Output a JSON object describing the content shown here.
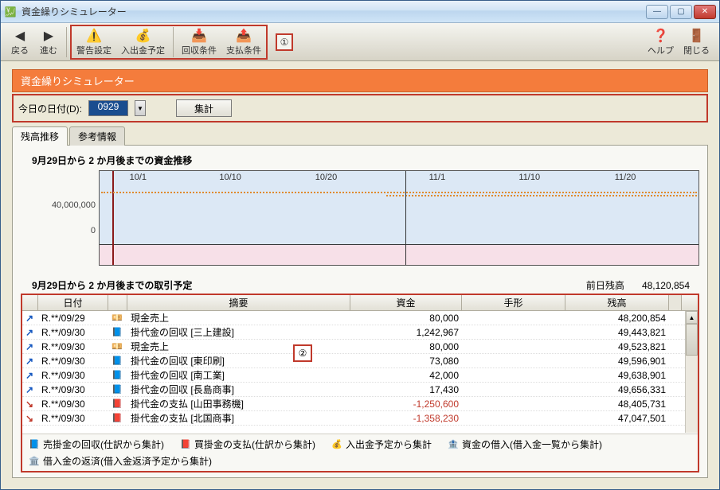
{
  "window": {
    "title": "資金繰りシミュレーター"
  },
  "toolbar": {
    "back": "戻る",
    "forward": "進む",
    "warn": "警告設定",
    "inout": "入出金予定",
    "kaishu": "回収条件",
    "shiharai": "支払条件",
    "help": "ヘルプ",
    "close": "閉じる"
  },
  "callouts": {
    "one": "①",
    "two": "②"
  },
  "header": {
    "title": "資金繰りシミュレーター"
  },
  "date": {
    "label": "今日の日付(D):",
    "value": "0929",
    "aggregate": "集計"
  },
  "tabs": {
    "balance": "残高推移",
    "reference": "参考情報"
  },
  "chart_section": {
    "title": "9月29日から 2 か月後までの資金推移"
  },
  "chart_data": {
    "type": "line",
    "title": "",
    "xlabel": "",
    "ylabel": "",
    "ylim": [
      0,
      50000000
    ],
    "yticks": [
      0,
      40000000
    ],
    "x_labels": [
      "10/1",
      "10/10",
      "10/20",
      "11/1",
      "11/10",
      "11/20"
    ],
    "x_positions_pct": [
      5,
      20,
      36,
      55,
      70,
      86
    ],
    "month_divider_pct": 51,
    "today_marker_pct": 2.2,
    "series": [
      {
        "name": "residual_cash",
        "color": "#e08a2e",
        "x_pct": [
          2,
          10,
          20,
          30,
          40,
          50,
          51,
          55,
          65,
          75,
          85,
          98
        ],
        "y_value": [
          48000000,
          48000000,
          48000000,
          48000000,
          48000000,
          48000000,
          45000000,
          45000000,
          45000000,
          45000000,
          45000000,
          45000000
        ]
      }
    ]
  },
  "table_section": {
    "title": "9月29日から 2 か月後までの取引予定",
    "prev_label": "前日残高",
    "prev_value": "48,120,854"
  },
  "columns": {
    "date": "日付",
    "desc": "摘要",
    "cash": "資金",
    "tegata": "手形",
    "balance": "残高"
  },
  "rows": [
    {
      "dir": "up",
      "date": "R.**/09/29",
      "icon": "cash",
      "desc": "現金売上",
      "cash": "80,000",
      "tegata": "",
      "balance": "48,200,854"
    },
    {
      "dir": "up",
      "date": "R.**/09/30",
      "icon": "recv",
      "desc": "掛代金の回収 [三上建設]",
      "cash": "1,242,967",
      "tegata": "",
      "balance": "49,443,821"
    },
    {
      "dir": "up",
      "date": "R.**/09/30",
      "icon": "cash",
      "desc": "現金売上",
      "cash": "80,000",
      "tegata": "",
      "balance": "49,523,821"
    },
    {
      "dir": "up",
      "date": "R.**/09/30",
      "icon": "recv",
      "desc": "掛代金の回収 [東印刷]",
      "cash": "73,080",
      "tegata": "",
      "balance": "49,596,901"
    },
    {
      "dir": "up",
      "date": "R.**/09/30",
      "icon": "recv",
      "desc": "掛代金の回収 [南工業]",
      "cash": "42,000",
      "tegata": "",
      "balance": "49,638,901"
    },
    {
      "dir": "up",
      "date": "R.**/09/30",
      "icon": "recv",
      "desc": "掛代金の回収 [長島商事]",
      "cash": "17,430",
      "tegata": "",
      "balance": "49,656,331"
    },
    {
      "dir": "down",
      "date": "R.**/09/30",
      "icon": "pay",
      "desc": "掛代金の支払 [山田事務機]",
      "cash": "-1,250,600",
      "tegata": "",
      "balance": "48,405,731"
    },
    {
      "dir": "down",
      "date": "R.**/09/30",
      "icon": "pay",
      "desc": "掛代金の支払 [北国商事]",
      "cash": "-1,358,230",
      "tegata": "",
      "balance": "47,047,501"
    }
  ],
  "legend": {
    "l1": "売掛金の回収(仕訳から集計)",
    "l2": "買掛金の支払(仕訳から集計)",
    "l3": "入出金予定から集計",
    "l4": "資金の借入(借入金一覧から集計)",
    "l5": "借入金の返済(借入金返済予定から集計)"
  }
}
